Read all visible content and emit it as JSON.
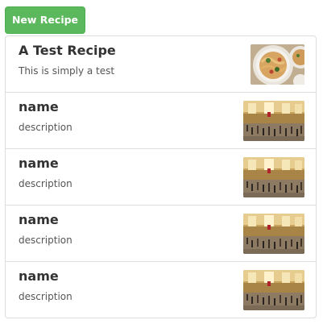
{
  "toolbar": {
    "new_recipe_label": "New Recipe"
  },
  "colors": {
    "button_bg": "#5cb85c",
    "border": "#dddddd",
    "text": "#333333"
  },
  "recipes": [
    {
      "name": "A Test Recipe",
      "description": "This is simply a test",
      "image": "pasta-dish-image"
    },
    {
      "name": "name",
      "description": "description",
      "image": "grand-central-terminal-image"
    },
    {
      "name": "name",
      "description": "description",
      "image": "grand-central-terminal-image"
    },
    {
      "name": "name",
      "description": "description",
      "image": "grand-central-terminal-image"
    },
    {
      "name": "name",
      "description": "description",
      "image": "grand-central-terminal-image"
    }
  ]
}
